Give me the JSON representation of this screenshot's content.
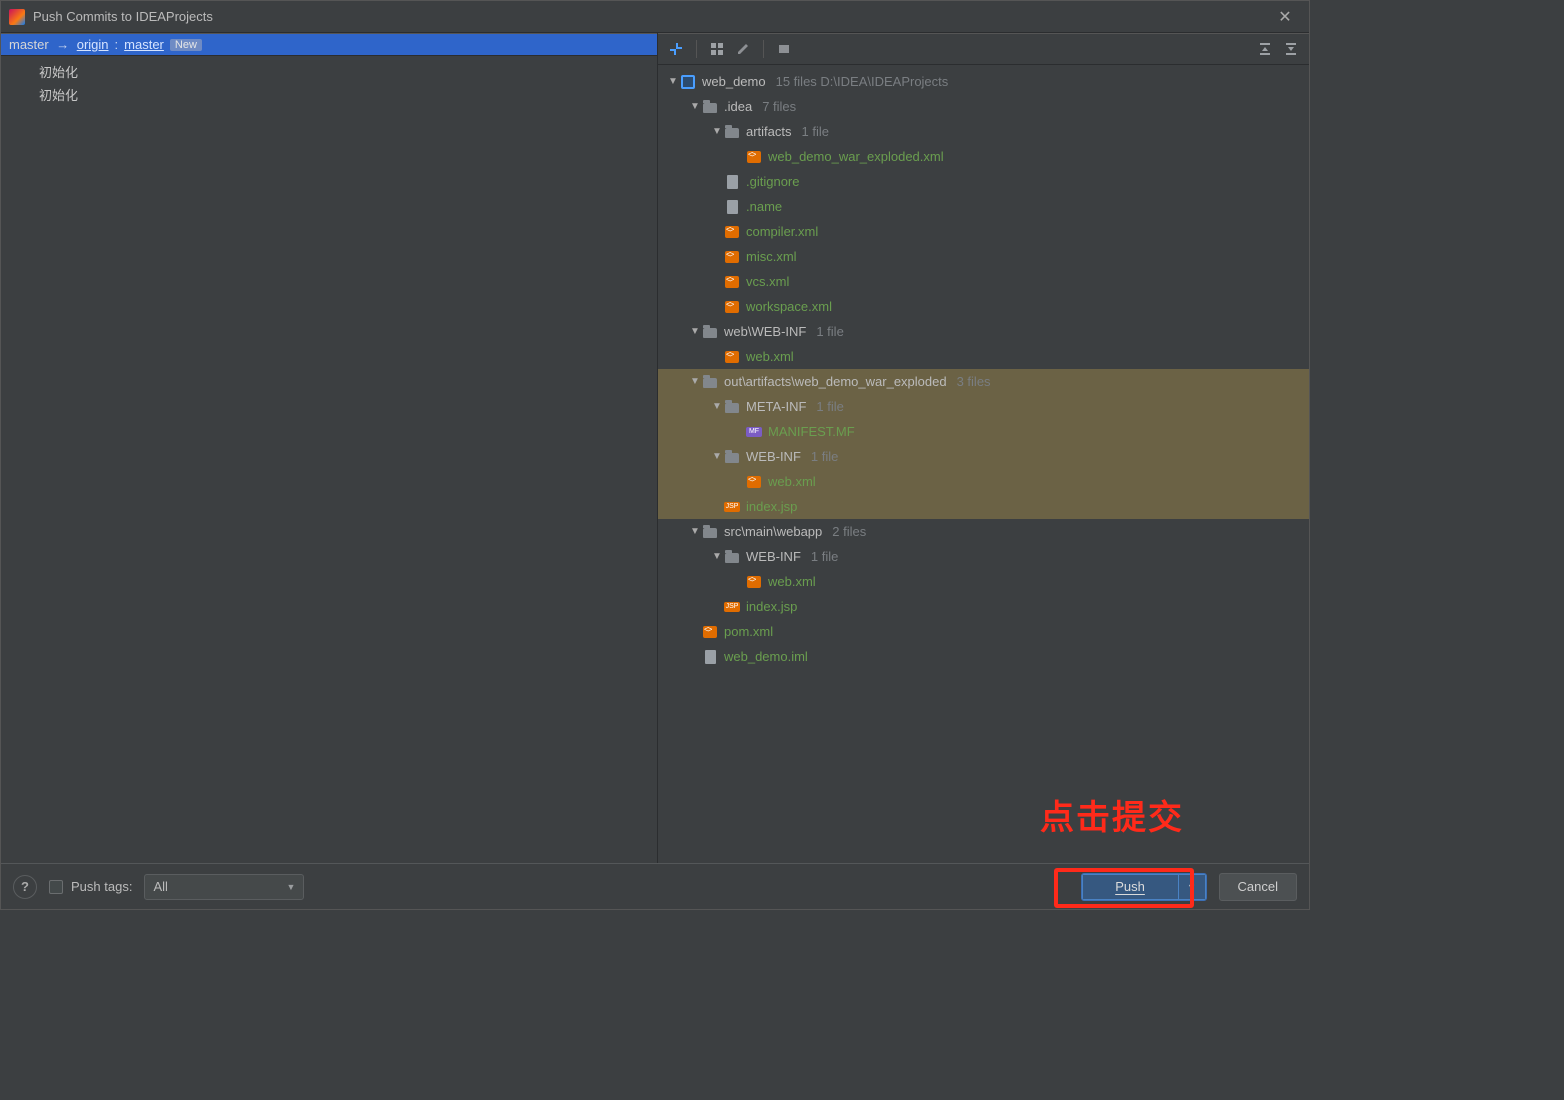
{
  "title": "Push Commits to IDEAProjects",
  "branch": {
    "local": "master",
    "remote": "origin",
    "remote_branch": "master",
    "badge": "New"
  },
  "commits": [
    "初始化",
    "初始化"
  ],
  "tree": [
    {
      "depth": 0,
      "chev": "down",
      "icon": "module",
      "label": "web_demo",
      "meta": "15 files  D:\\IDEA\\IDEAProjects",
      "green": false,
      "sel": false
    },
    {
      "depth": 1,
      "chev": "down",
      "icon": "folder",
      "label": ".idea",
      "meta": "7 files",
      "green": false,
      "sel": false
    },
    {
      "depth": 2,
      "chev": "down",
      "icon": "folder",
      "label": "artifacts",
      "meta": "1 file",
      "green": false,
      "sel": false
    },
    {
      "depth": 3,
      "chev": "",
      "icon": "xml",
      "label": "web_demo_war_exploded.xml",
      "meta": "",
      "green": true,
      "sel": false
    },
    {
      "depth": 2,
      "chev": "",
      "icon": "file",
      "label": ".gitignore",
      "meta": "",
      "green": true,
      "sel": false
    },
    {
      "depth": 2,
      "chev": "",
      "icon": "file",
      "label": ".name",
      "meta": "",
      "green": true,
      "sel": false
    },
    {
      "depth": 2,
      "chev": "",
      "icon": "xml",
      "label": "compiler.xml",
      "meta": "",
      "green": true,
      "sel": false
    },
    {
      "depth": 2,
      "chev": "",
      "icon": "xml",
      "label": "misc.xml",
      "meta": "",
      "green": true,
      "sel": false
    },
    {
      "depth": 2,
      "chev": "",
      "icon": "xml",
      "label": "vcs.xml",
      "meta": "",
      "green": true,
      "sel": false
    },
    {
      "depth": 2,
      "chev": "",
      "icon": "xml",
      "label": "workspace.xml",
      "meta": "",
      "green": true,
      "sel": false
    },
    {
      "depth": 1,
      "chev": "down",
      "icon": "folder",
      "label": "web\\WEB-INF",
      "meta": "1 file",
      "green": false,
      "sel": false
    },
    {
      "depth": 2,
      "chev": "",
      "icon": "xml",
      "label": "web.xml",
      "meta": "",
      "green": true,
      "sel": false
    },
    {
      "depth": 1,
      "chev": "down",
      "icon": "folder",
      "label": "out\\artifacts\\web_demo_war_exploded",
      "meta": "3 files",
      "green": false,
      "sel": true
    },
    {
      "depth": 2,
      "chev": "down",
      "icon": "folder",
      "label": "META-INF",
      "meta": "1 file",
      "green": false,
      "sel": true
    },
    {
      "depth": 3,
      "chev": "",
      "icon": "mf",
      "label": "MANIFEST.MF",
      "meta": "",
      "green": true,
      "sel": true
    },
    {
      "depth": 2,
      "chev": "down",
      "icon": "folder",
      "label": "WEB-INF",
      "meta": "1 file",
      "green": false,
      "sel": true
    },
    {
      "depth": 3,
      "chev": "",
      "icon": "xml",
      "label": "web.xml",
      "meta": "",
      "green": true,
      "sel": true
    },
    {
      "depth": 2,
      "chev": "",
      "icon": "jsp",
      "label": "index.jsp",
      "meta": "",
      "green": true,
      "sel": true
    },
    {
      "depth": 1,
      "chev": "down",
      "icon": "folder",
      "label": "src\\main\\webapp",
      "meta": "2 files",
      "green": false,
      "sel": false
    },
    {
      "depth": 2,
      "chev": "down",
      "icon": "folder",
      "label": "WEB-INF",
      "meta": "1 file",
      "green": false,
      "sel": false
    },
    {
      "depth": 3,
      "chev": "",
      "icon": "xml",
      "label": "web.xml",
      "meta": "",
      "green": true,
      "sel": false
    },
    {
      "depth": 2,
      "chev": "",
      "icon": "jsp",
      "label": "index.jsp",
      "meta": "",
      "green": true,
      "sel": false
    },
    {
      "depth": 1,
      "chev": "",
      "icon": "xml",
      "label": "pom.xml",
      "meta": "",
      "green": true,
      "sel": false
    },
    {
      "depth": 1,
      "chev": "",
      "icon": "file",
      "label": "web_demo.iml",
      "meta": "",
      "green": true,
      "sel": false
    }
  ],
  "bottom": {
    "push_tags_label": "Push tags:",
    "push_tags_value": "All",
    "push_label": "Push",
    "cancel_label": "Cancel",
    "help_label": "?"
  },
  "annotation": "点击提交"
}
